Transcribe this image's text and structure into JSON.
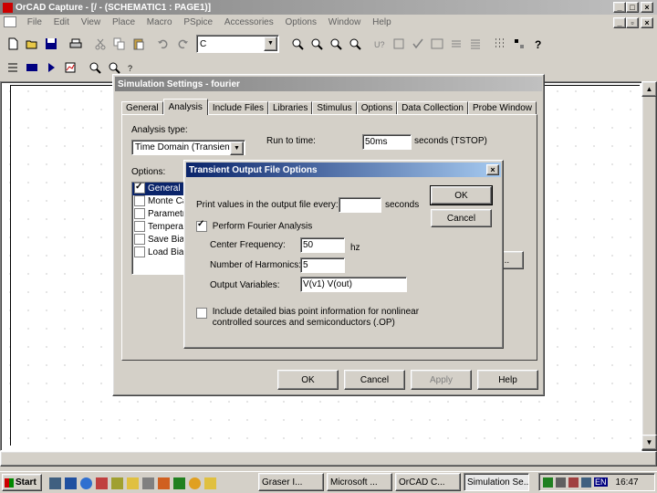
{
  "app": {
    "title": "OrCAD Capture - [/ - (SCHEMATIC1 : PAGE1)]"
  },
  "menu": [
    "File",
    "Edit",
    "View",
    "Place",
    "Macro",
    "PSpice",
    "Accessories",
    "Options",
    "Window",
    "Help"
  ],
  "toolbar": {
    "part_combo_value": "C"
  },
  "sim_dialog": {
    "title": "Simulation Settings - fourier",
    "tabs": [
      "General",
      "Analysis",
      "Include Files",
      "Libraries",
      "Stimulus",
      "Options",
      "Data Collection",
      "Probe Window"
    ],
    "active_tab": "Analysis",
    "analysis_type_label": "Analysis type:",
    "analysis_type_value": "Time Domain (Transient)",
    "run_to_label": "Run to time:",
    "run_to_value": "50ms",
    "run_to_unit": "seconds  (TSTOP)",
    "options_label": "Options:",
    "options": [
      {
        "label": "General Settings",
        "checked": true
      },
      {
        "label": "Monte Carlo/Worst Case",
        "checked": false
      },
      {
        "label": "Parametric Sweep",
        "checked": false
      },
      {
        "label": "Temperature (Sweep)",
        "checked": false
      },
      {
        "label": "Save Bias Point",
        "checked": false
      },
      {
        "label": "Load Bias Point",
        "checked": false
      }
    ],
    "side_button": "...",
    "ok": "OK",
    "cancel": "Cancel",
    "apply": "Apply",
    "help": "Help"
  },
  "output_dialog": {
    "title": "Transient Output File Options",
    "print_values_label": "Print values in the output file every:",
    "print_values_value": "",
    "print_values_unit": "seconds",
    "perform_fourier_label": "Perform Fourier Analysis",
    "perform_fourier_checked": true,
    "center_freq_label": "Center Frequency:",
    "center_freq_value": "50",
    "center_freq_unit": "hz",
    "harmonics_label": "Number of Harmonics:",
    "harmonics_value": "5",
    "output_vars_label": "Output Variables:",
    "output_vars_value": "V(v1) V(out)",
    "bias_label_1": "Include detailed bias point information for nonlinear",
    "bias_label_2": "controlled sources and semiconductors (.OP)",
    "bias_checked": false,
    "ok": "OK",
    "cancel": "Cancel"
  },
  "taskbar": {
    "start": "Start",
    "tasks": [
      "Graser I...",
      "Microsoft ...",
      "OrCAD C...",
      "Simulation Se..."
    ],
    "active_task": "Simulation Se...",
    "lang": "EN",
    "clock": "16:47"
  }
}
